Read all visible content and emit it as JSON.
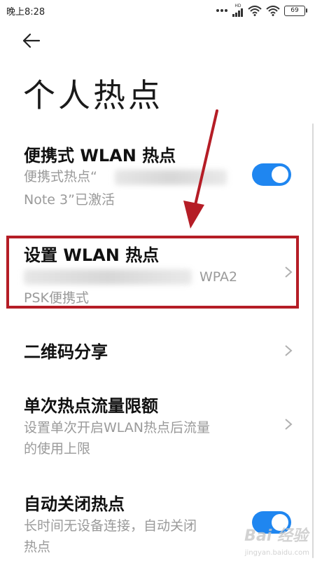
{
  "status_bar": {
    "time": "晚上8:28",
    "network_label": "HD",
    "battery_level": "69"
  },
  "header": {
    "back_icon": "back-arrow-icon",
    "title": "个人热点"
  },
  "items": [
    {
      "title": "便携式 WLAN 热点",
      "subtitle_line1": "便携式热点“",
      "subtitle_line2": "Note 3”已激活",
      "toggle_on": true
    },
    {
      "title": "设置 WLAN 热点",
      "subtitle_line1": "WPA2",
      "subtitle_line2": "PSK便携式",
      "chevron": "chevron-right-icon"
    },
    {
      "title": "二维码分享",
      "chevron": "chevron-right-icon"
    },
    {
      "title": "单次热点流量限额",
      "subtitle_line1": "设置单次开启WLAN热点后流量",
      "subtitle_line2": "的使用上限",
      "chevron": "chevron-right-icon"
    },
    {
      "title": "自动关闭热点",
      "subtitle_line1": "长时间无设备连接，自动关闭",
      "subtitle_line2": "热点",
      "toggle_on": true
    }
  ],
  "colors": {
    "accent": "#1f86f0",
    "annotation": "#b51d26",
    "subtext": "#9a9a9a"
  },
  "watermark": {
    "text": "Bai 经验",
    "sub": "jingyan.baidu.com"
  }
}
